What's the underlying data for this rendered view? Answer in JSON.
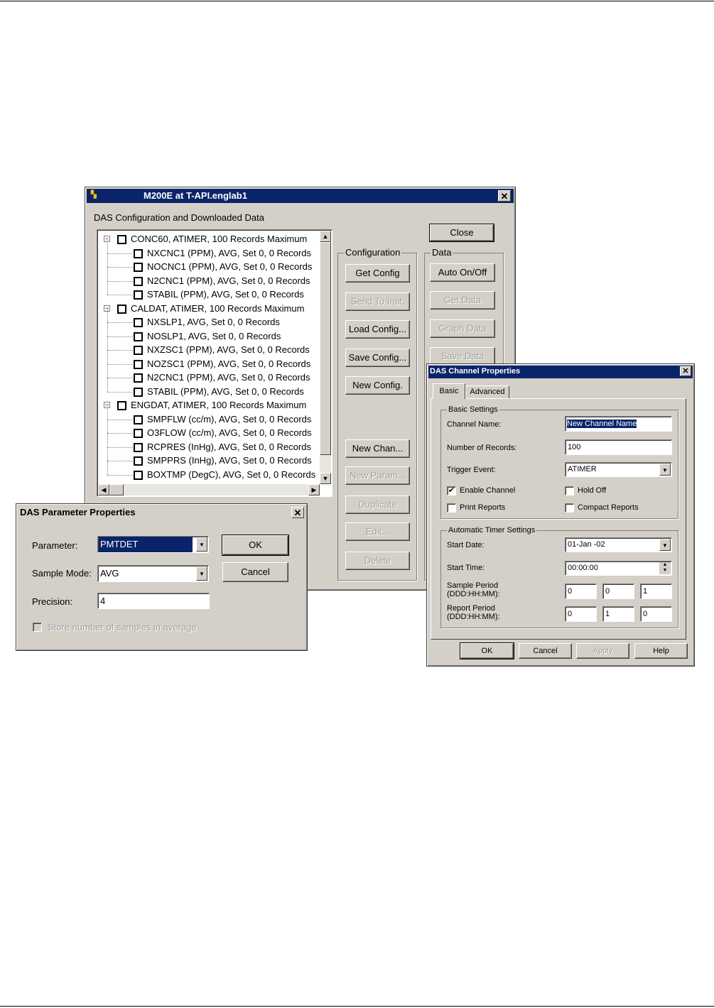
{
  "main_window": {
    "title": "M200E   at T-API.englab1",
    "heading": "DAS Configuration and Downloaded Data",
    "close_button": "Close",
    "configuration_group": "Configuration",
    "data_group": "Data",
    "config_buttons": [
      "Get Config",
      "Send To Inst.",
      "Load Config...",
      "Save Config...",
      "New Config."
    ],
    "data_buttons": [
      "Auto On/Off",
      "Get Data",
      "Graph Data",
      "Save Data"
    ],
    "chan_buttons": [
      "New Chan...",
      "New Param...",
      "Duplicate",
      "Edit...",
      "Delete"
    ],
    "tree": [
      {
        "level": 0,
        "text": "CONC60, ATIMER, 100 Records Maximum"
      },
      {
        "level": 1,
        "text": "NXCNC1 (PPM), AVG, Set 0, 0 Records"
      },
      {
        "level": 1,
        "text": "NOCNC1 (PPM), AVG, Set 0, 0 Records"
      },
      {
        "level": 1,
        "text": "N2CNC1 (PPM), AVG, Set 0, 0 Records"
      },
      {
        "level": 1,
        "text": "STABIL (PPM), AVG, Set 0, 0 Records"
      },
      {
        "level": 0,
        "text": "CALDAT, ATIMER, 100 Records Maximum"
      },
      {
        "level": 1,
        "text": "NXSLP1, AVG, Set 0, 0 Records"
      },
      {
        "level": 1,
        "text": "NOSLP1, AVG, Set 0, 0 Records"
      },
      {
        "level": 1,
        "text": "NXZSC1 (PPM), AVG, Set 0, 0 Records"
      },
      {
        "level": 1,
        "text": "NOZSC1 (PPM), AVG, Set 0, 0 Records"
      },
      {
        "level": 1,
        "text": "N2CNC1 (PPM), AVG, Set 0, 0 Records"
      },
      {
        "level": 1,
        "text": "STABIL (PPM), AVG, Set 0, 0 Records"
      },
      {
        "level": 0,
        "text": "ENGDAT, ATIMER, 100 Records Maximum"
      },
      {
        "level": 1,
        "text": "SMPFLW (cc/m), AVG, Set 0, 0 Records"
      },
      {
        "level": 1,
        "text": "O3FLOW (cc/m), AVG, Set 0, 0 Records"
      },
      {
        "level": 1,
        "text": "RCPRES (InHg), AVG, Set 0, 0 Records"
      },
      {
        "level": 1,
        "text": "SMPPRS (InHg), AVG, Set 0, 0 Records"
      },
      {
        "level": 1,
        "text": "BOXTMP (DegC), AVG, Set 0, 0 Records"
      }
    ]
  },
  "param_dialog": {
    "title": "DAS Parameter Properties",
    "parameter_label": "Parameter:",
    "parameter_value": "PMTDET",
    "sample_mode_label": "Sample Mode:",
    "sample_mode_value": "AVG",
    "precision_label": "Precision:",
    "precision_value": "4",
    "store_samples_label": "Store number of samples in average",
    "ok": "OK",
    "cancel": "Cancel"
  },
  "channel_dialog": {
    "title": "DAS Channel Properties",
    "tabs": [
      "Basic",
      "Advanced"
    ],
    "basic_settings": "Basic Settings",
    "channel_name_label": "Channel Name:",
    "channel_name_value": "New Channel Name",
    "num_records_label": "Number of Records:",
    "num_records_value": "100",
    "trigger_label": "Trigger Event:",
    "trigger_value": "ATIMER",
    "enable_channel": "Enable Channel",
    "enable_channel_checked": true,
    "hold_off": "Hold Off",
    "print_reports": "Print Reports",
    "compact_reports": "Compact Reports",
    "timer_settings": "Automatic Timer Settings",
    "start_date_label": "Start Date:",
    "start_date_value": "01-Jan -02",
    "start_time_label": "Start Time:",
    "start_time_value": "00:00:00",
    "sample_period_label": "Sample Period",
    "report_period_label": "Report Period",
    "period_format": "(DDD:HH:MM):",
    "sample_period": [
      "0",
      "0",
      "1"
    ],
    "report_period": [
      "0",
      "1",
      "0"
    ],
    "ok": "OK",
    "cancel": "Cancel",
    "apply": "Apply",
    "help": "Help"
  }
}
